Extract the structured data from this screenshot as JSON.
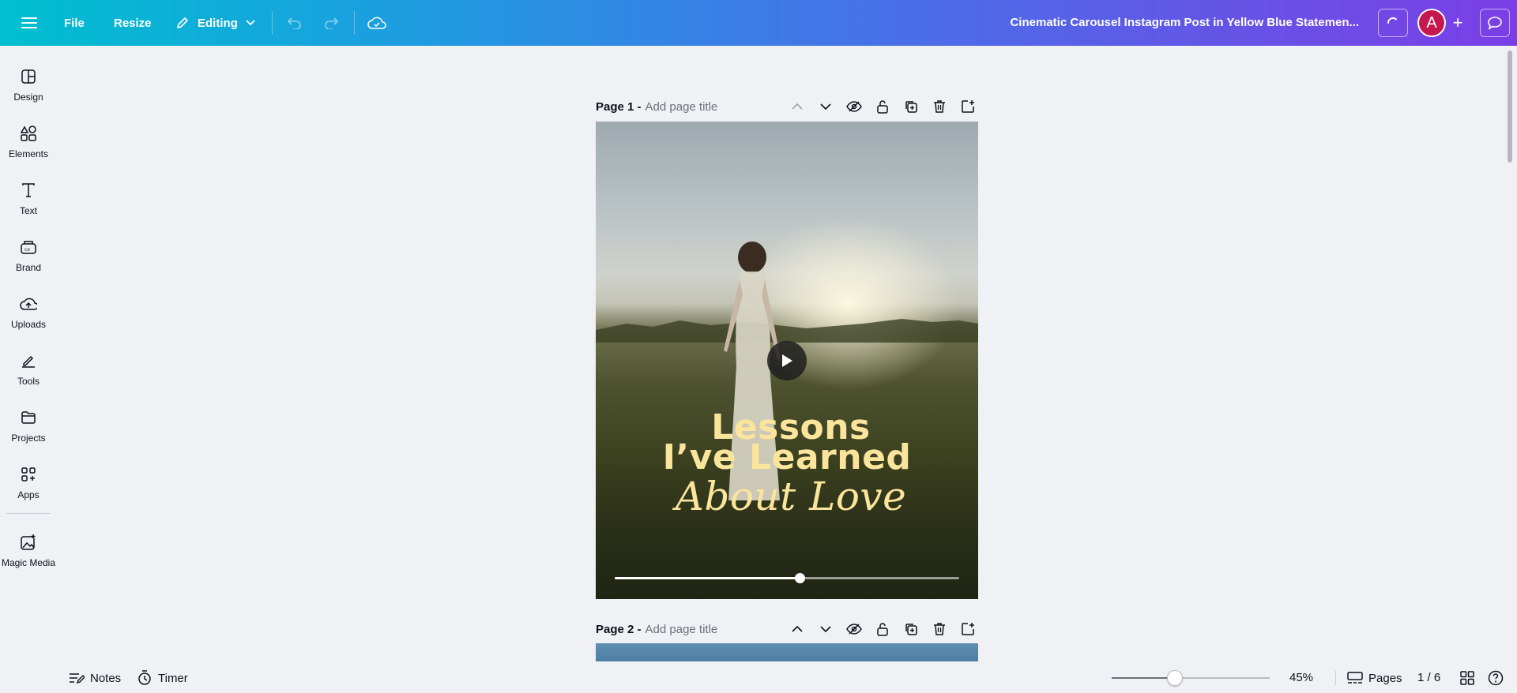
{
  "topbar": {
    "file_label": "File",
    "resize_label": "Resize",
    "editing_label": "Editing",
    "doc_title": "Cinematic Carousel Instagram Post in Yellow Blue Statemen...",
    "avatar_initial": "A"
  },
  "sidebar": {
    "items": [
      {
        "label": "Design",
        "icon": "design-icon"
      },
      {
        "label": "Elements",
        "icon": "elements-icon"
      },
      {
        "label": "Text",
        "icon": "text-icon"
      },
      {
        "label": "Brand",
        "icon": "brand-icon"
      },
      {
        "label": "Uploads",
        "icon": "uploads-icon"
      },
      {
        "label": "Tools",
        "icon": "tools-icon"
      },
      {
        "label": "Projects",
        "icon": "projects-icon"
      },
      {
        "label": "Apps",
        "icon": "apps-icon"
      },
      {
        "label": "Magic Media",
        "icon": "magic-media-icon"
      }
    ]
  },
  "pages": [
    {
      "number_label": "Page 1 -",
      "title_placeholder": "Add page title"
    },
    {
      "number_label": "Page 2 -",
      "title_placeholder": "Add page title"
    }
  ],
  "canvas": {
    "heading_line1": "Lessons",
    "heading_line2": "I’ve Learned",
    "heading_line3": "About Love",
    "text_color": "#fbe59c",
    "video_progress": 0.536
  },
  "bottombar": {
    "notes_label": "Notes",
    "timer_label": "Timer",
    "zoom_value": "45%",
    "zoom_level": 0.4,
    "pages_label": "Pages",
    "page_count": "1 / 6"
  }
}
